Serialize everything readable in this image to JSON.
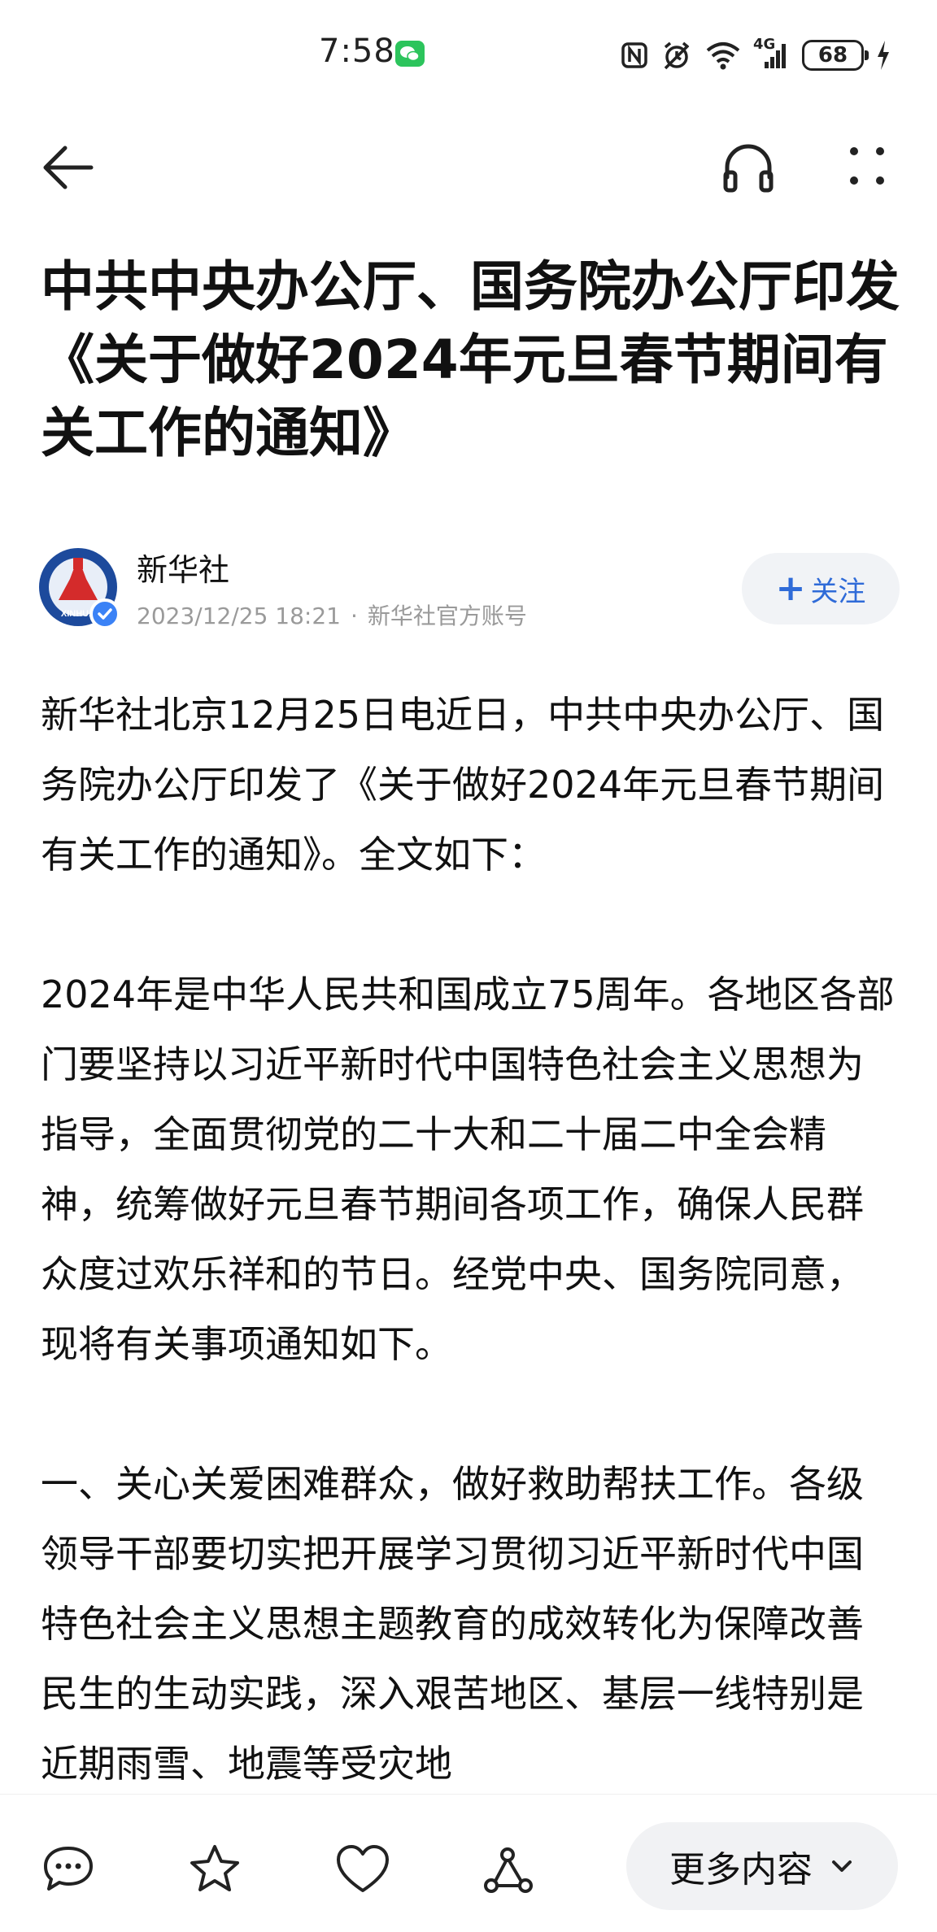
{
  "status_bar": {
    "time": "7:58",
    "network": "4G",
    "battery": "68",
    "icons": [
      "wechat-icon",
      "nfc-icon",
      "alarm-icon",
      "wifi-icon",
      "signal-icon",
      "battery-icon",
      "charging-icon"
    ]
  },
  "nav": {
    "icons": [
      "back-arrow-icon",
      "headphones-icon",
      "more-dots-icon"
    ]
  },
  "article": {
    "title": "中共中央办公厅、国务院办公厅印发《关于做好2024年元旦春节期间有关工作的通知》",
    "author": {
      "name": "新华社",
      "date": "2023/12/25 18:21",
      "separator": "·",
      "account": "新华社官方账号",
      "avatar_text": "XINHUA"
    },
    "follow_label": "关注",
    "paragraphs": [
      "新华社北京12月25日电近日，中共中央办公厅、国务院办公厅印发了《关于做好2024年元旦春节期间有关工作的通知》。全文如下：",
      "2024年是中华人民共和国成立75周年。各地区各部门要坚持以习近平新时代中国特色社会主义思想为指导，全面贯彻党的二十大和二十届二中全会精神，统筹做好元旦春节期间各项工作，确保人民群众度过欢乐祥和的节日。经党中央、国务院同意，现将有关事项通知如下。",
      "一、关心关爱困难群众，做好救助帮扶工作。各级领导干部要切实把开展学习贯彻习近平新时代中国特色社会主义思想主题教育的成效转化为保障改善民生的生动实践，深入艰苦地区、基层一线特别是近期雨雪、地震等受灾地"
    ]
  },
  "bottom_bar": {
    "icons": [
      "comment-icon",
      "star-icon",
      "heart-icon",
      "share-icon"
    ],
    "more_label": "更多内容"
  },
  "colors": {
    "accent": "#2f6bd8",
    "wechat": "#2cc45c",
    "meta_text": "#9a9a9a"
  }
}
